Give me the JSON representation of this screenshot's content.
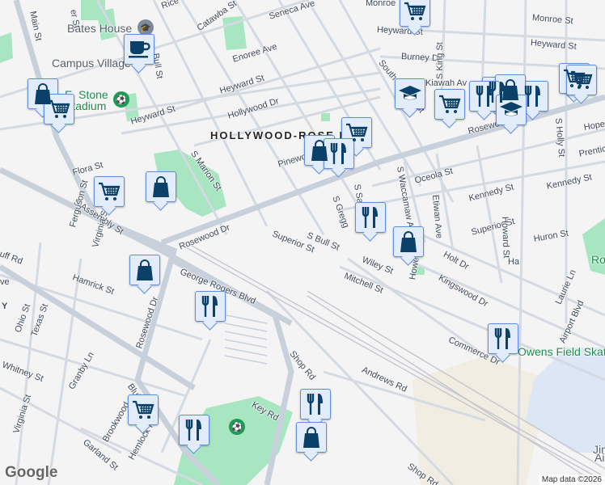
{
  "map": {
    "colors": {
      "background": "#f5f4f5",
      "road": "#d3dae2",
      "major_road": "#c8d1db",
      "park": "#a8e6c1",
      "airport": "#dde6f4",
      "industrial": "#f1ede2",
      "marker_fill": "#e3ecfb",
      "marker_border": "#5f8fdc",
      "icon": "#0b4168"
    },
    "neighborhood": "HOLLYWOOD-ROSE HI",
    "pois": {
      "bates_house": "Bates House",
      "campus_village": "Campus Village",
      "stadium": "E. Stone Stadium",
      "skate_park": "Owens Field Skate Park",
      "airport_partial_1": "Jim",
      "airport_partial_2": "Ai",
      "rose_partial": "Ro"
    },
    "streets": [
      "Main St",
      "er St",
      "Rice",
      "Catawba St",
      "Seneca Ave",
      "Bull St",
      "Enoree Ave",
      "Heyward St",
      "Heyward St",
      "Hollywood Dr",
      "Flora St",
      "S Marion St",
      "Pinewo",
      "S Assembly St",
      "Rosewood Dr",
      "Superior St",
      "Ferguson St",
      "Virginia St",
      "Hamrick St",
      "Rosewood Dr",
      "George Rogers Blvd",
      "S Bull St",
      "Wiley St",
      "Mitchell St",
      "S Gregg",
      "S Saluda",
      "Monroe",
      "Monroe St",
      "Heyward St",
      "Heyward St",
      "Burney Dr",
      "S King St",
      "South Harden St",
      "Kiawah Av",
      "Rosewood Dr",
      "S Holly St",
      "Hope",
      "Prentice",
      "Oceola St",
      "S Waccamaw Ave",
      "Etiwan Ave",
      "Kennedy St",
      "Kennedy St",
      "Superior St",
      "Huron St",
      "Howard St",
      "Holt Dr",
      "Kingswood Dr",
      "Howe St",
      "Laurie Ln",
      "Airport Blvd",
      "Commerce Dr",
      "Andrews Rd",
      "Shop Rd",
      "Shop Rd",
      "Key Rd",
      "Whitney St",
      "Ohio St",
      "Texas St",
      "Granby Ln",
      "Bluff",
      "Brookwood",
      "Garland St",
      "Hemlock Rd",
      "Virginia St",
      "uff Rd",
      "ve",
      "Y",
      "Ha"
    ],
    "markers": [
      "shopping-cart",
      "coffee",
      "shopping-bag",
      "shopping-cart",
      "shopping-cart",
      "shopping-bag",
      "education",
      "shopping-cart",
      "restaurant",
      "restaurant",
      "shopping-bag",
      "restaurant",
      "education",
      "shopping-cart",
      "shopping-cart",
      "shopping-bag",
      "restaurant",
      "restaurant",
      "shopping-bag",
      "shopping-bag",
      "restaurant",
      "restaurant",
      "shopping-cart",
      "shopping-cart",
      "restaurant",
      "restaurant",
      "shopping-bag"
    ],
    "logo": "Google",
    "attribution": "Map data ©2026"
  }
}
